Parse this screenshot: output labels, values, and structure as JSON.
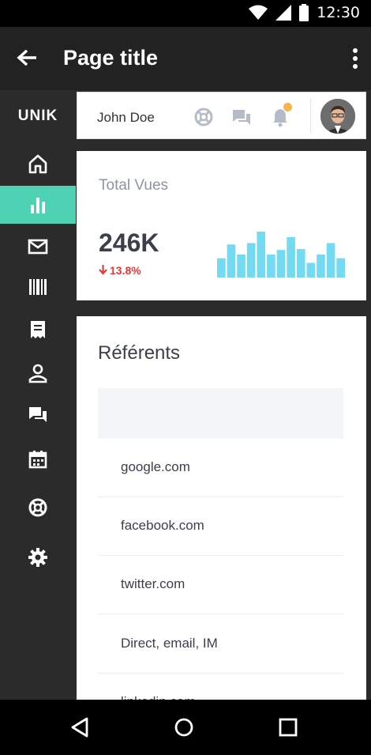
{
  "status_bar": {
    "time": "12:30",
    "icons": [
      "wifi-icon",
      "signal-icon",
      "battery-icon"
    ]
  },
  "app_bar": {
    "title": "Page title",
    "back_icon": "arrow-back-icon",
    "more_icon": "more-vert-icon"
  },
  "sidebar": {
    "brand": "UNIK",
    "accent_color": "#4fd1b3",
    "items": [
      {
        "icon": "home-icon",
        "active": false
      },
      {
        "icon": "bar-chart-icon",
        "active": true
      },
      {
        "icon": "mail-icon",
        "active": false
      },
      {
        "icon": "barcode-icon",
        "active": false
      },
      {
        "icon": "receipt-icon",
        "active": false
      },
      {
        "icon": "person-icon",
        "active": false
      },
      {
        "icon": "chat-icon",
        "active": false
      },
      {
        "icon": "calendar-icon",
        "active": false
      },
      {
        "icon": "support-icon",
        "active": false
      },
      {
        "icon": "settings-icon",
        "active": false
      }
    ]
  },
  "header": {
    "user_name": "John Doe",
    "icons": [
      "support-icon",
      "chat-icon",
      "bell-icon"
    ],
    "notification_color": "#f5b54a"
  },
  "stats": {
    "label": "Total Vues",
    "value": "246K",
    "change": "13.8%",
    "change_direction": "down",
    "bar_color": "#5cd3ee",
    "sparkline": [
      0.42,
      0.72,
      0.5,
      0.75,
      1.0,
      0.5,
      0.6,
      0.88,
      0.62,
      0.32,
      0.5,
      0.75,
      0.42
    ]
  },
  "referents": {
    "title": "Référents",
    "rows": [
      "google.com",
      "facebook.com",
      "twitter.com",
      "Direct, email, IM",
      "linkedin.com"
    ]
  }
}
